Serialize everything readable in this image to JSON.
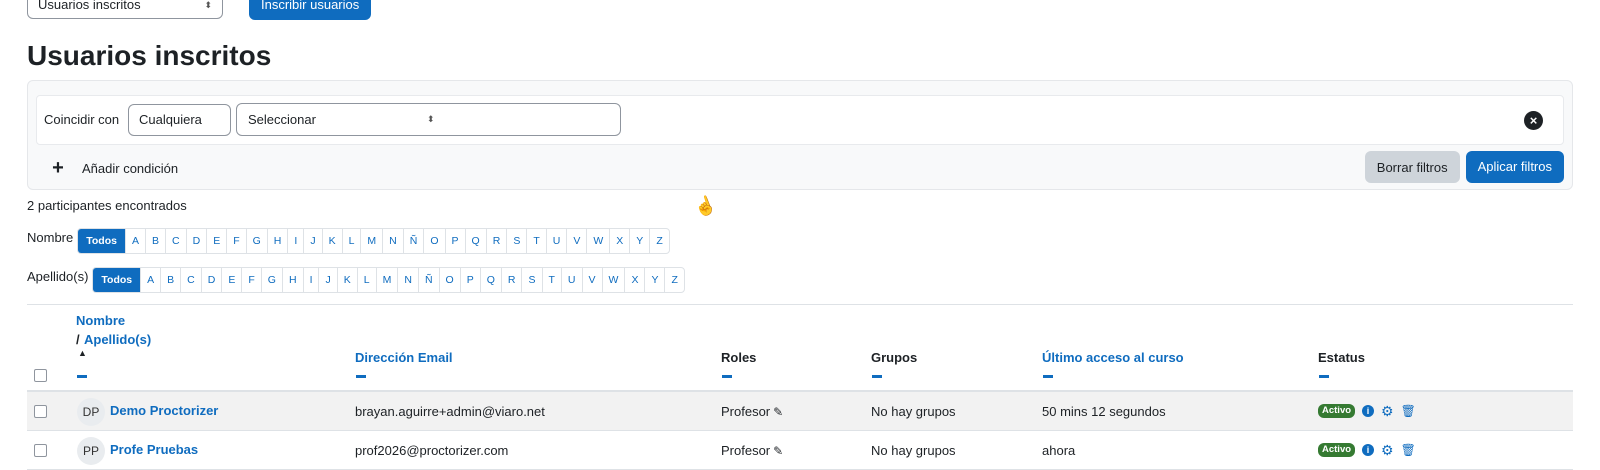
{
  "top": {
    "enrol_select": "Usuarios inscritos",
    "enrol_button": "Inscribir usuarios"
  },
  "title": "Usuarios inscritos",
  "filters": {
    "match_label": "Coincidir con",
    "match_value": "Cualquiera",
    "type_value": "Seleccionar",
    "add_condition": "Añadir condición",
    "clear_button": "Borrar filtros",
    "apply_button": "Aplicar filtros"
  },
  "count_text": "2 participantes encontrados",
  "initials": {
    "first_label": "Nombre",
    "last_label": "Apellido(s)",
    "all_label": "Todos",
    "letters": [
      "A",
      "B",
      "C",
      "D",
      "E",
      "F",
      "G",
      "H",
      "I",
      "J",
      "K",
      "L",
      "M",
      "N",
      "Ñ",
      "O",
      "P",
      "Q",
      "R",
      "S",
      "T",
      "U",
      "V",
      "W",
      "X",
      "Y",
      "Z"
    ]
  },
  "table": {
    "headers": {
      "name_first": "Nombre",
      "name_sep": "/",
      "name_last": "Apellido(s)",
      "email": "Dirección Email",
      "roles": "Roles",
      "groups": "Grupos",
      "last_access": "Último acceso al curso",
      "status": "Estatus"
    },
    "rows": [
      {
        "initials": "DP",
        "name": "Demo Proctorizer",
        "email": "brayan.aguirre+admin@viaro.net",
        "role": "Profesor",
        "groups": "No hay grupos",
        "last_access": "50 mins 12 segundos",
        "status": "Activo"
      },
      {
        "initials": "PP",
        "name": "Profe Pruebas",
        "email": "prof2026@proctorizer.com",
        "role": "Profesor",
        "groups": "No hay grupos",
        "last_access": "ahora",
        "status": "Activo"
      }
    ]
  },
  "icons": {
    "sort_arrow": "caret-up-icon",
    "remove": "close-circle-icon",
    "add": "plus-icon",
    "edit": "pencil-icon",
    "info": "info-icon",
    "settings": "gear-icon",
    "delete": "trash-icon"
  },
  "colors": {
    "primary": "#0f6cbf",
    "active_badge": "#357a32"
  }
}
